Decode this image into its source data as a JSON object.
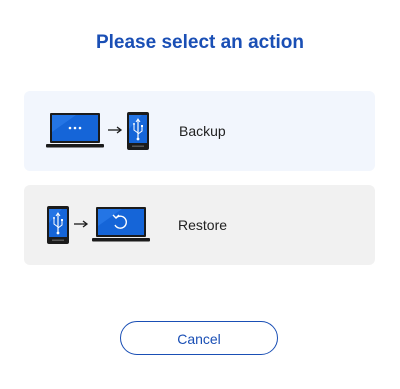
{
  "dialog": {
    "title": "Please select an action",
    "options": [
      {
        "label": "Backup",
        "icons": [
          "laptop-icon",
          "arrow-right-icon",
          "usb-device-icon"
        ]
      },
      {
        "label": "Restore",
        "icons": [
          "usb-device-icon",
          "arrow-right-icon",
          "laptop-restore-icon"
        ]
      }
    ],
    "cancel_label": "Cancel"
  },
  "colors": {
    "accent": "#1a4fb5",
    "backup_bg": "#f2f6fd",
    "restore_bg": "#f1f1f1",
    "screen_blue": "#1565d8"
  }
}
